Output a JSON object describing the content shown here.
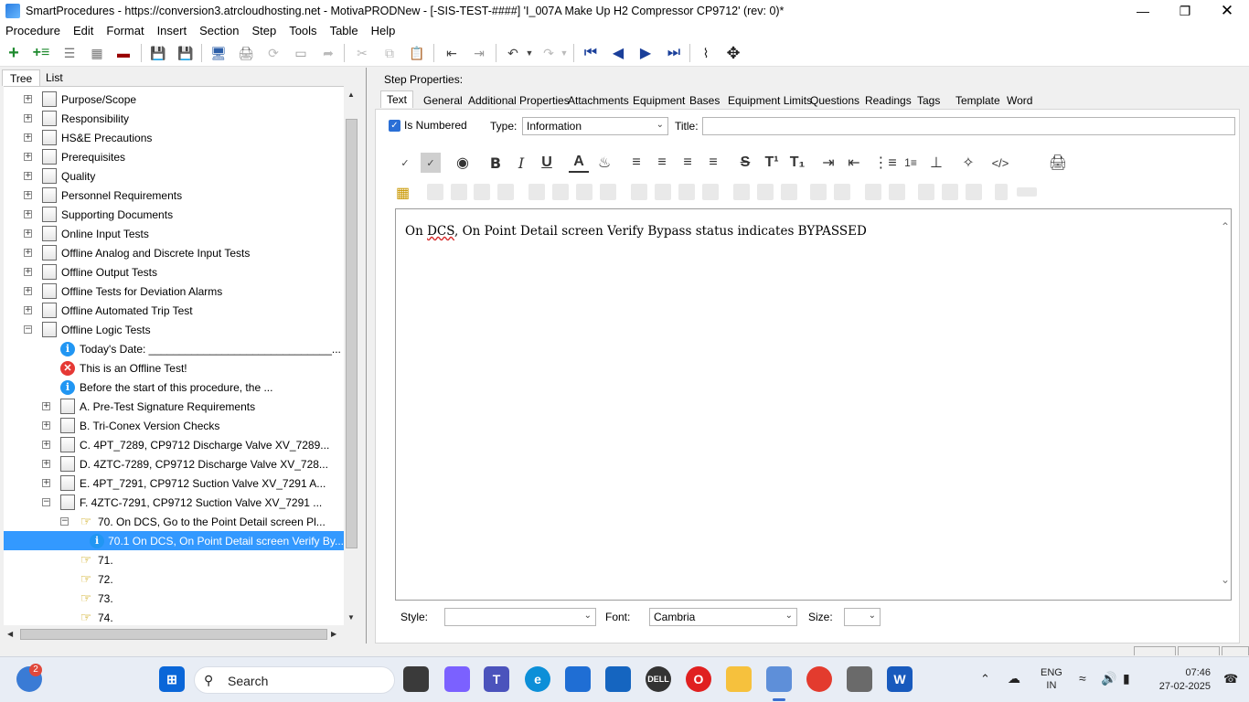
{
  "window": {
    "title": "SmartProcedures - https://conversion3.atrcloudhosting.net - MotivaPRODNew - [-SIS-TEST-####] 'I_007A Make Up H2 Compressor CP9712' (rev: 0)*"
  },
  "menu": [
    "Procedure",
    "Edit",
    "Format",
    "Insert",
    "Section",
    "Step",
    "Tools",
    "Table",
    "Help"
  ],
  "left_tabs": [
    "Tree",
    "List"
  ],
  "tree": [
    {
      "label": "Purpose/Scope",
      "type": "doc",
      "exp": "+"
    },
    {
      "label": "Responsibility",
      "type": "doc",
      "exp": "+"
    },
    {
      "label": "HS&E Precautions",
      "type": "doc",
      "exp": "+"
    },
    {
      "label": "Prerequisites",
      "type": "doc",
      "exp": "+"
    },
    {
      "label": "Quality",
      "type": "doc",
      "exp": "+"
    },
    {
      "label": "Personnel Requirements",
      "type": "doc",
      "exp": "+"
    },
    {
      "label": "Supporting Documents",
      "type": "doc",
      "exp": "+"
    },
    {
      "label": "Online Input Tests",
      "type": "doc",
      "exp": "+"
    },
    {
      "label": "Offline Analog and Discrete Input Tests",
      "type": "doc",
      "exp": "+"
    },
    {
      "label": "Offline Output Tests",
      "type": "doc",
      "exp": "+"
    },
    {
      "label": "Offline Tests for Deviation Alarms",
      "type": "doc",
      "exp": "+"
    },
    {
      "label": "Offline Automated Trip Test",
      "type": "doc",
      "exp": "+"
    },
    {
      "label": "Offline Logic Tests",
      "type": "doc",
      "exp": "−"
    },
    {
      "label": "Today's Date: ______________________________...",
      "type": "info",
      "exp": ""
    },
    {
      "label": "This is an Offline Test!",
      "type": "err",
      "exp": ""
    },
    {
      "label": "Before the start of this procedure, the ...",
      "type": "info",
      "exp": ""
    },
    {
      "label": "A. Pre-Test Signature Requirements",
      "type": "doc",
      "exp": "+"
    },
    {
      "label": "B. Tri-Conex Version Checks",
      "type": "doc",
      "exp": "+"
    },
    {
      "label": "C. 4PT_7289, CP9712 Discharge Valve XV_7289...",
      "type": "doc",
      "exp": "+"
    },
    {
      "label": "D. 4ZTC-7289, CP9712 Discharge Valve XV_728...",
      "type": "doc",
      "exp": "+"
    },
    {
      "label": "E. 4PT_7291, CP9712 Suction Valve XV_7291 A...",
      "type": "doc",
      "exp": "+"
    },
    {
      "label": "F. 4ZTC-7291, CP9712 Suction Valve XV_7291 ...",
      "type": "doc",
      "exp": "−"
    },
    {
      "label": "70. On DCS, Go to the Point Detail screen Pl...",
      "type": "hand",
      "exp": "−"
    },
    {
      "label": "70.1 On DCS, On Point Detail screen Verify By...",
      "type": "info",
      "exp": ""
    },
    {
      "label": "71.",
      "type": "hand",
      "exp": ""
    },
    {
      "label": "72.",
      "type": "hand",
      "exp": ""
    },
    {
      "label": "73.",
      "type": "hand",
      "exp": ""
    },
    {
      "label": "74.",
      "type": "hand",
      "exp": ""
    }
  ],
  "step_properties": {
    "heading": "Step Properties:",
    "tabs": [
      "Text",
      "General",
      "Additional Properties",
      "Attachments",
      "Equipment",
      "Bases",
      "Equipment Limits",
      "Questions",
      "Readings",
      "Tags",
      "Template",
      "Word"
    ],
    "is_numbered_label": "Is Numbered",
    "type_label": "Type:",
    "type_value": "Information",
    "title_label": "Title:",
    "title_value": "",
    "editor_text_before": "On ",
    "editor_text_spell": "DCS",
    "editor_text_after": ", On Point Detail screen Verify Bypass status indicates BYPASSED",
    "style_label": "Style:",
    "style_value": "",
    "font_label": "Font:",
    "font_value": "Cambria",
    "size_label": "Size:",
    "size_value": ""
  },
  "taskbar": {
    "search": "Search",
    "lang_top": "ENG",
    "lang_bottom": "IN",
    "time": "07:46",
    "date": "27-02-2025",
    "badge": "2"
  }
}
